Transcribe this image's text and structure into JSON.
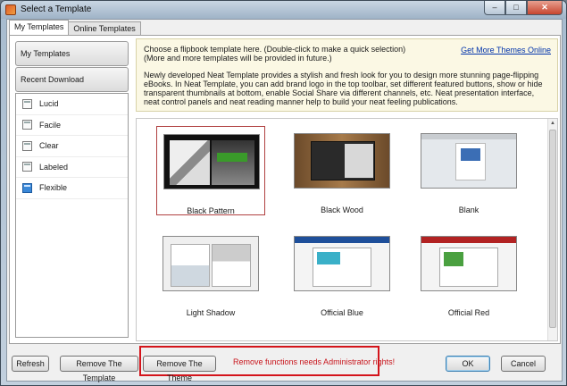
{
  "window": {
    "title": "Select a Template",
    "controls": {
      "min": "–",
      "max": "□",
      "close": "✕"
    }
  },
  "tabs": [
    {
      "label": "My Templates",
      "active": true
    },
    {
      "label": "Online Templates",
      "active": false
    }
  ],
  "sidebar": {
    "my_templates": "My Templates",
    "recent_download": "Recent Download",
    "items": [
      {
        "label": "Lucid",
        "icon": "page-icon"
      },
      {
        "label": "Facile",
        "icon": "page-icon"
      },
      {
        "label": "Clear",
        "icon": "page-icon"
      },
      {
        "label": "Labeled",
        "icon": "page-icon"
      },
      {
        "label": "Flexible",
        "icon": "flexible-page-icon"
      }
    ]
  },
  "info": {
    "line1": "Choose a flipbook template here. (Double-click to make a quick selection)",
    "line2": "(More and more templates will be provided in future.)",
    "more_link": "Get More Themes Online",
    "para2": "Newly developed Neat Template provides a stylish and fresh look for you to design more stunning page-flipping eBooks. In Neat Template, you can add brand logo in the top toolbar, set different featured buttons, show or hide transparent thumbnails at bottom, enable Social Share via different channels, etc. Neat presentation interface, neat control panels and neat reading manner help to build your neat feeling publications."
  },
  "templates": [
    {
      "name": "Black Pattern",
      "selected": true
    },
    {
      "name": "Black Wood",
      "selected": false
    },
    {
      "name": "Blank",
      "selected": false
    },
    {
      "name": "Light Shadow",
      "selected": false
    },
    {
      "name": "Official Blue",
      "selected": false
    },
    {
      "name": "Official Red",
      "selected": false
    }
  ],
  "footer": {
    "refresh": "Refresh",
    "remove_template": "Remove The Template",
    "remove_theme": "Remove The Theme",
    "warning": "Remove functions needs Administrator rights!",
    "ok": "OK",
    "cancel": "Cancel"
  },
  "colors": {
    "warning": "#c8141b",
    "link": "#0033aa",
    "info_bg": "#fbf8e4"
  }
}
